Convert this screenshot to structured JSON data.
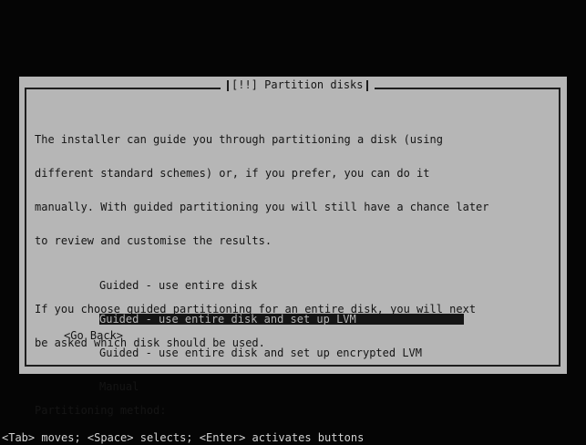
{
  "dialog": {
    "title": "[!!] Partition disks",
    "paragraph1": [
      "The installer can guide you through partitioning a disk (using",
      "different standard schemes) or, if you prefer, you can do it",
      "manually. With guided partitioning you will still have a chance later",
      "to review and customise the results."
    ],
    "paragraph2": [
      "If you choose guided partitioning for an entire disk, you will next",
      "be asked which disk should be used."
    ],
    "prompt": "Partitioning method:",
    "methods": [
      "Guided - use entire disk",
      "Guided - use entire disk and set up LVM",
      "Guided - use entire disk and set up encrypted LVM",
      "Manual"
    ],
    "selected_method": "Guided - use entire disk and set up LVM",
    "go_back": "<Go Back>"
  },
  "statusbar": {
    "text": "<Tab> moves; <Space> selects; <Enter> activates buttons"
  },
  "colors": {
    "dialog_bg": "#b6b6b6",
    "screen_bg": "#050505",
    "text": "#151515",
    "highlight_bg": "#151515"
  }
}
